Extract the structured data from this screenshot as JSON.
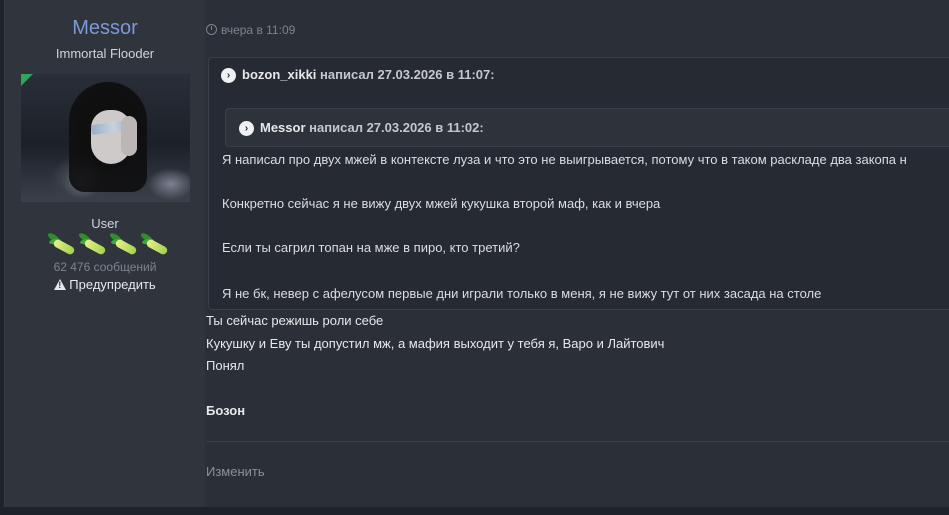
{
  "author": {
    "name": "Messor",
    "title": "Immortal Flooder",
    "group": "User",
    "message_count": "62 476 сообщений",
    "warn_label": "Предупредить"
  },
  "post": {
    "timestamp": "вчера в 11:09",
    "quote": {
      "author": "bozon_xikki",
      "said": "написал 27.03.2026 в 11:07:",
      "nested": {
        "author": "Messor",
        "said": "написал 27.03.2026 в 11:02:"
      },
      "lines": [
        "Я написал про двух мжей в контексте луза и что это не выигрывается, потому что в таком раскладе два закопа н",
        "Конкретно сейчас я не вижу двух мжей кукушка второй маф, как и вчера",
        "Если ты сагрил топан на мже в пиро, кто третий?",
        "Я не бк, невер с афелусом первые дни играли только в меня, я не вижу тут от них засада на столе"
      ]
    },
    "body_lines": [
      "Ты сейчас режишь роли себе",
      "Кукушку и Еву ты допустил мж, а мафия выходит у тебя я, Варо и Лайтович",
      "Понял"
    ],
    "signature": "Бозон",
    "edit_label": "Изменить"
  },
  "colors": {
    "username": "#7b99d6",
    "background": "#2b2f38",
    "quote_bg": "#262a32"
  }
}
